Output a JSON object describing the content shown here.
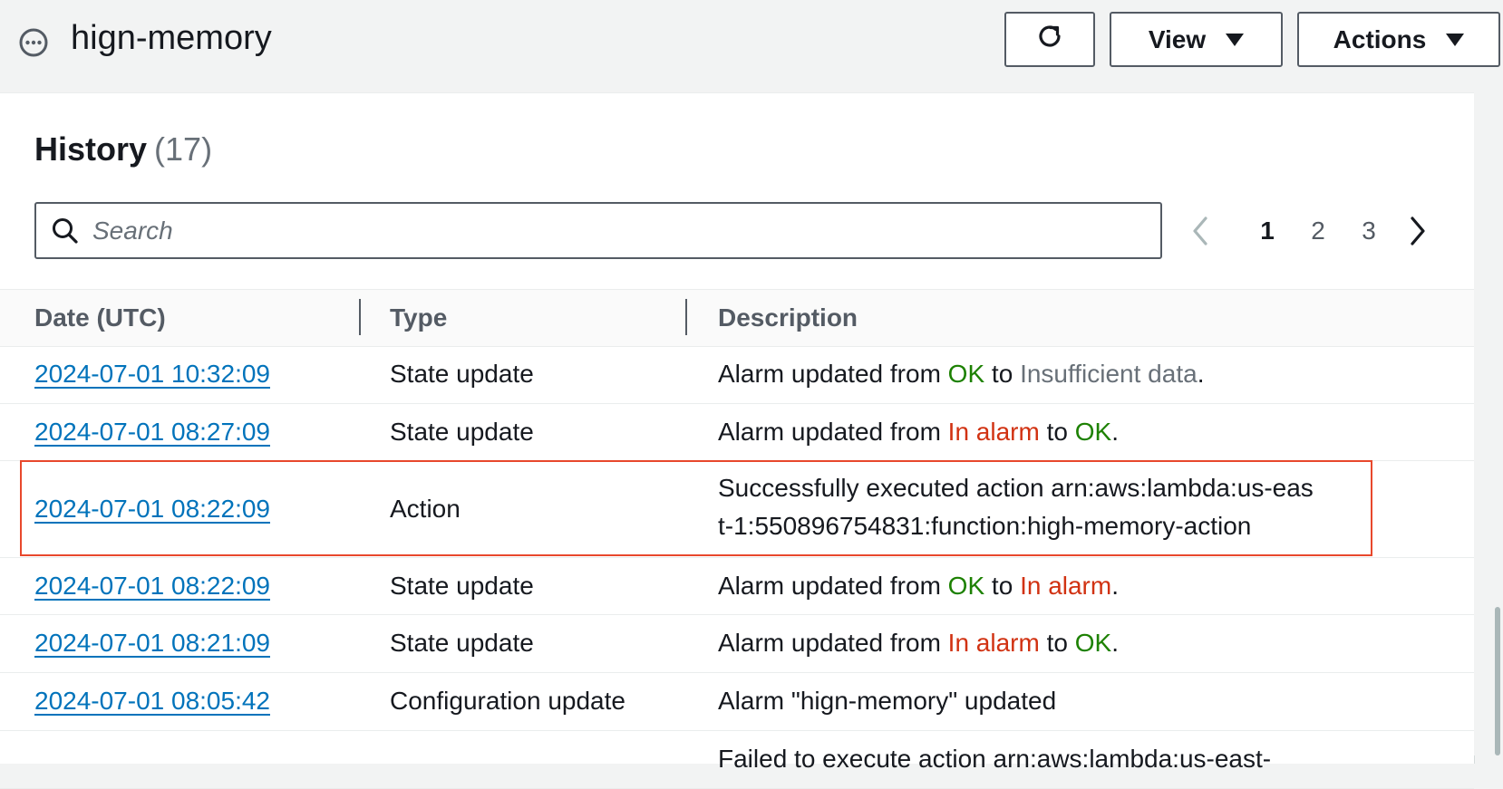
{
  "header": {
    "title": "hign-memory",
    "state_icon": "insufficient-data-icon",
    "refresh_icon": "refresh-icon",
    "view_label": "View",
    "actions_label": "Actions"
  },
  "history": {
    "title": "History",
    "count": "(17)",
    "search_placeholder": "Search",
    "search_value": "",
    "pages": [
      "1",
      "2",
      "3"
    ],
    "current_page": "1"
  },
  "table": {
    "columns": [
      "Date (UTC)",
      "Type",
      "Description"
    ],
    "rows": [
      {
        "date": "2024-07-01 10:32:09",
        "type": "State update",
        "desc": [
          {
            "text": "Alarm updated from ",
            "tone": "plain"
          },
          {
            "text": "OK",
            "tone": "ok"
          },
          {
            "text": " to ",
            "tone": "plain"
          },
          {
            "text": "Insufficient data",
            "tone": "insuf"
          },
          {
            "text": ".",
            "tone": "plain"
          }
        ]
      },
      {
        "date": "2024-07-01 08:27:09",
        "type": "State update",
        "desc": [
          {
            "text": "Alarm updated from ",
            "tone": "plain"
          },
          {
            "text": "In alarm",
            "tone": "alarm"
          },
          {
            "text": " to ",
            "tone": "plain"
          },
          {
            "text": "OK",
            "tone": "ok"
          },
          {
            "text": ".",
            "tone": "plain"
          }
        ]
      },
      {
        "date": "2024-07-01 08:22:09",
        "type": "Action",
        "desc": [
          {
            "text": "Successfully executed action arn:aws:lambda:us-east-1:550896754831:function:high-memory-action",
            "tone": "plain"
          }
        ]
      },
      {
        "date": "2024-07-01 08:22:09",
        "type": "State update",
        "desc": [
          {
            "text": "Alarm updated from ",
            "tone": "plain"
          },
          {
            "text": "OK",
            "tone": "ok"
          },
          {
            "text": " to ",
            "tone": "plain"
          },
          {
            "text": "In alarm",
            "tone": "alarm"
          },
          {
            "text": ".",
            "tone": "plain"
          }
        ]
      },
      {
        "date": "2024-07-01 08:21:09",
        "type": "State update",
        "desc": [
          {
            "text": "Alarm updated from ",
            "tone": "plain"
          },
          {
            "text": "In alarm",
            "tone": "alarm"
          },
          {
            "text": " to ",
            "tone": "plain"
          },
          {
            "text": "OK",
            "tone": "ok"
          },
          {
            "text": ".",
            "tone": "plain"
          }
        ]
      },
      {
        "date": "2024-07-01 08:05:42",
        "type": "Configuration update",
        "desc": [
          {
            "text": "Alarm \"hign-memory\" updated",
            "tone": "plain"
          }
        ]
      },
      {
        "date": "",
        "type": "",
        "desc": [
          {
            "text": "Failed to execute action arn:aws:lambda:us-east-",
            "tone": "plain"
          }
        ]
      }
    ]
  },
  "colors": {
    "link": "#0073bb",
    "ok": "#1d8102",
    "alarm": "#d13212",
    "insufficient": "#687078",
    "highlight": "#e8482c"
  }
}
